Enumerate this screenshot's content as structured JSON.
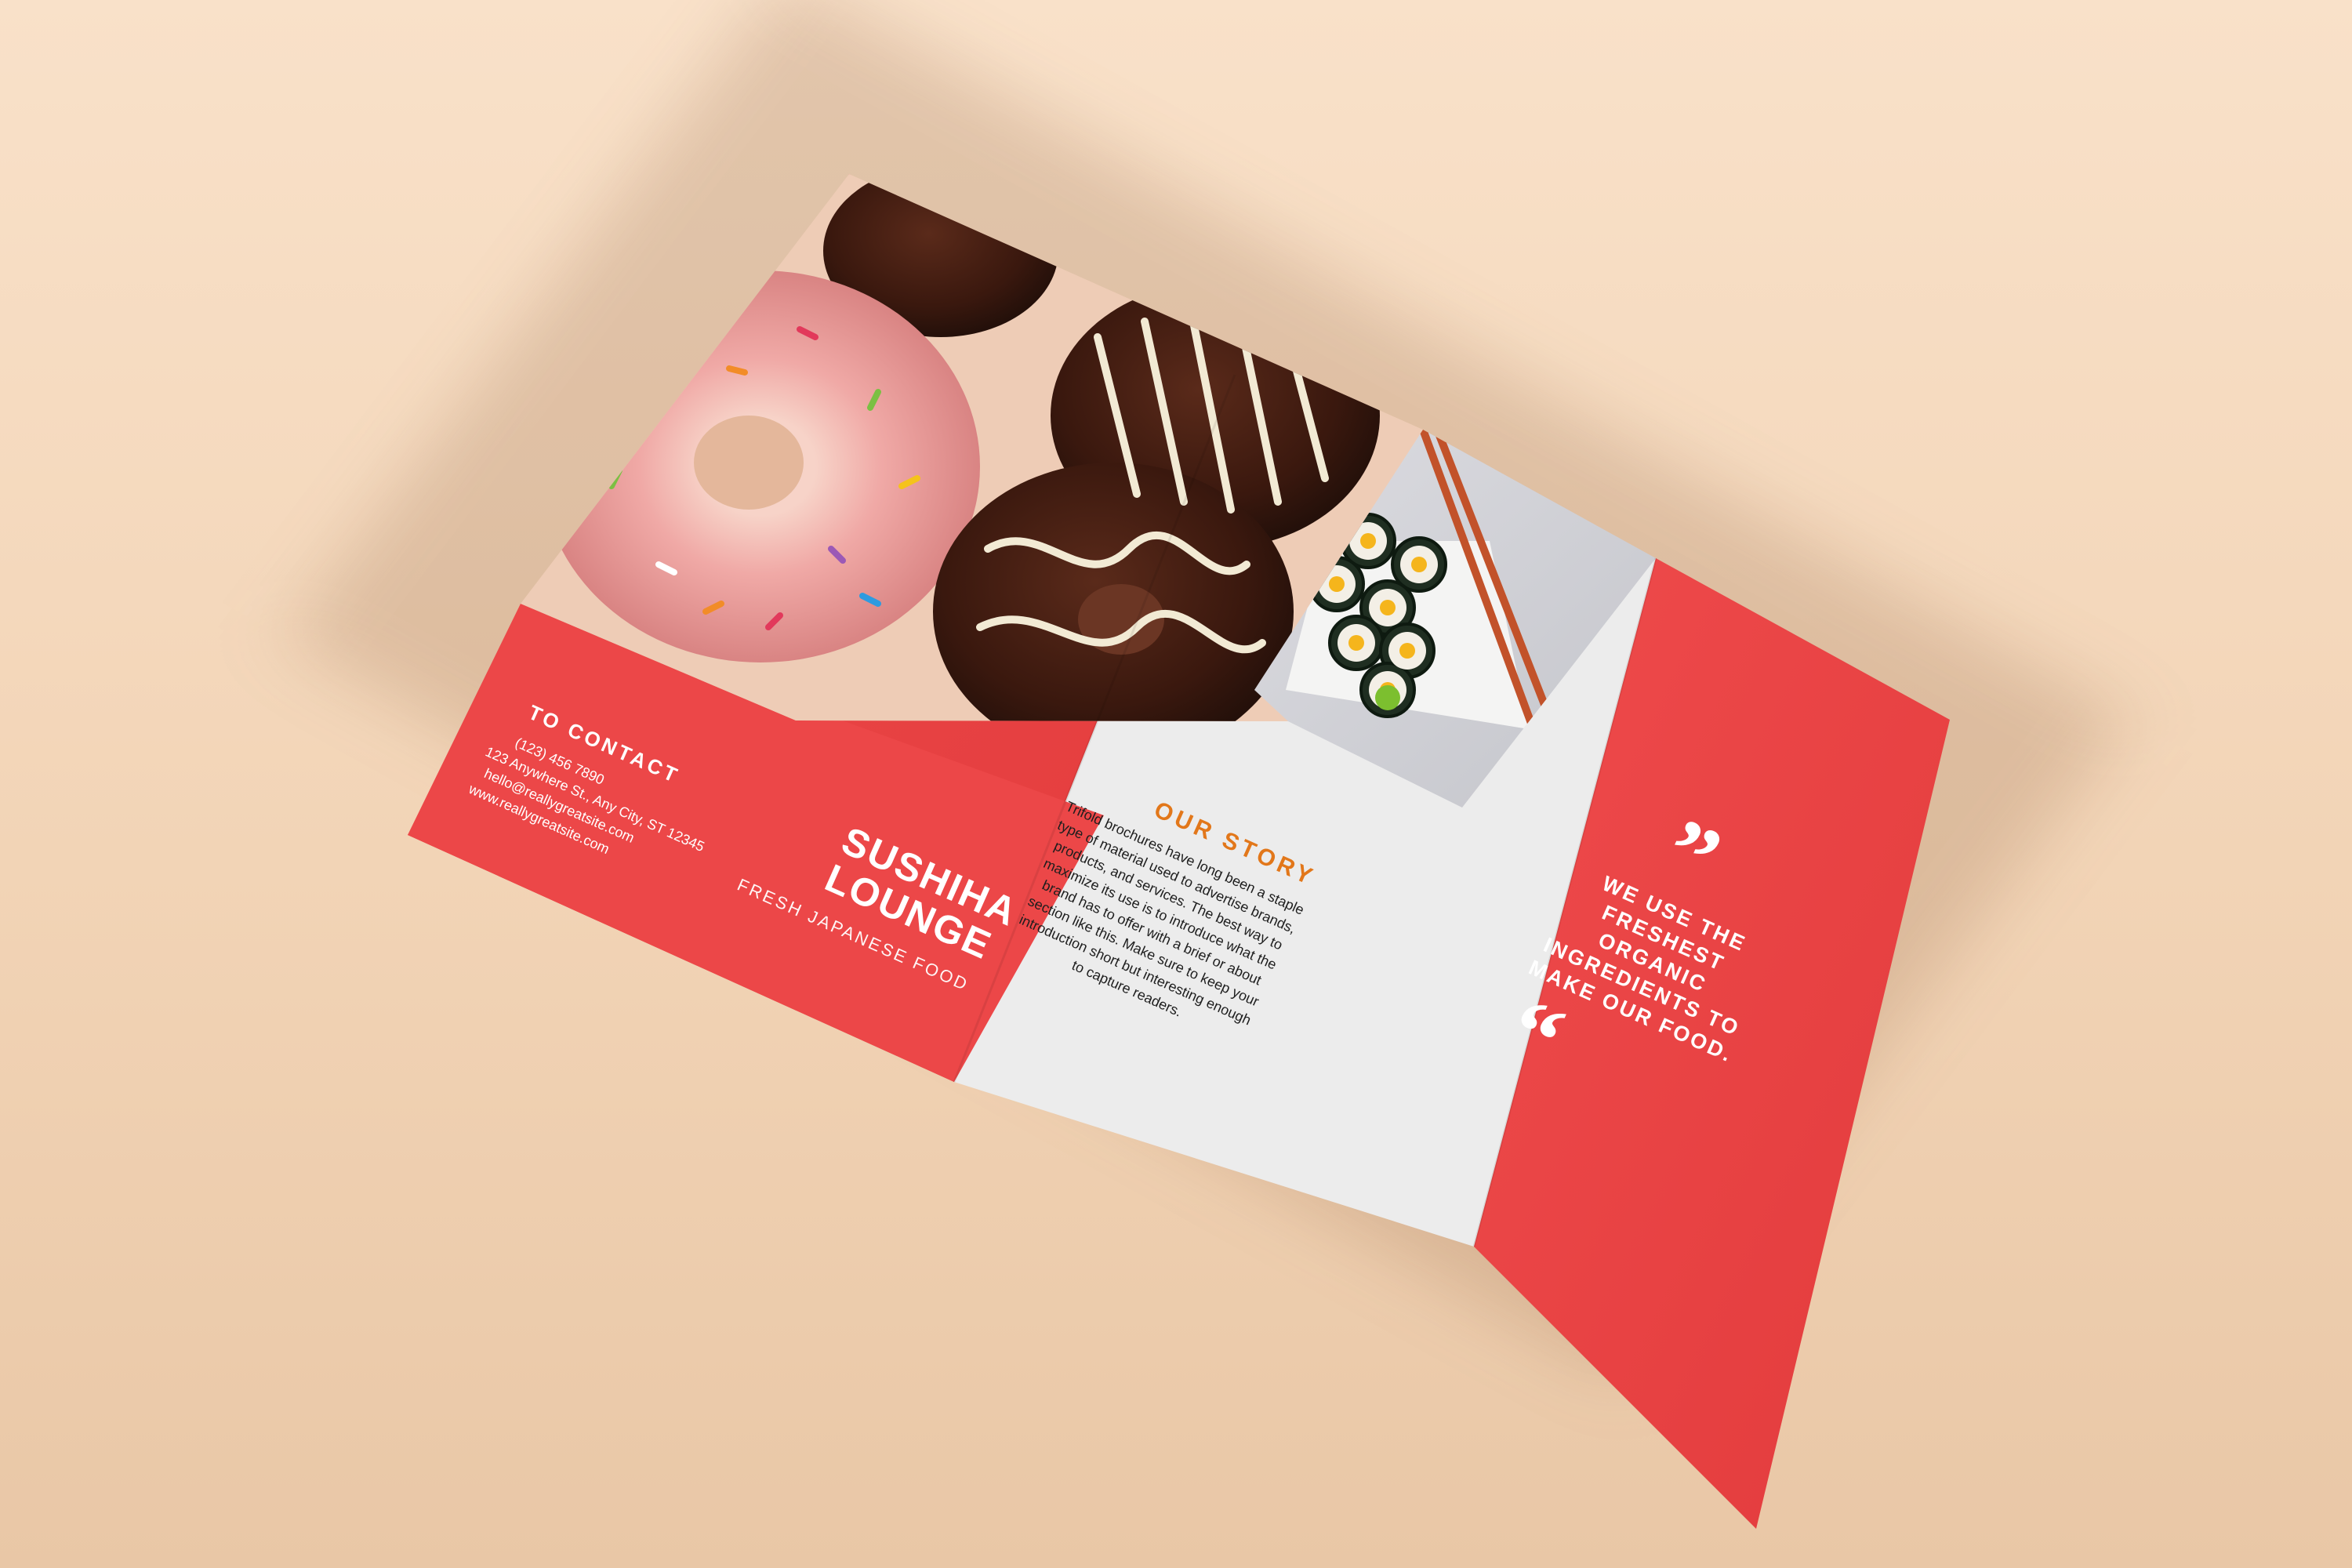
{
  "brochure": {
    "contact": {
      "heading": "TO CONTACT",
      "phone": "(123) 456 7890",
      "address": "123 Anywhere St., Any City, ST 12345",
      "email": "hello@reallygreatsite.com",
      "website": "www.reallygreatsite.com"
    },
    "brand": {
      "name_line1": "SUSHIHA",
      "name_line2": "LOUNGE",
      "tagline": "FRESH JAPANESE FOOD"
    },
    "story": {
      "heading": "OUR STORY",
      "body": "Trifold brochures have long been a staple type of material used to advertise brands, products, and services. The best way to maximize its use is to introduce what the brand has to offer with a brief or about section like this. Make sure to keep your introduction short but interesting enough to capture readers."
    },
    "quote": {
      "open_mark": "”",
      "text": "WE USE THE FRESHEST ORGANIC INGREDIENTS TO MAKE OUR FOOD.",
      "close_mark": "“"
    },
    "colors": {
      "red": "#ec4748",
      "red_dark": "#e33a3c",
      "panel_grey": "#ececec",
      "story_orange": "#e2771a",
      "background": "#f6dcc2"
    }
  }
}
